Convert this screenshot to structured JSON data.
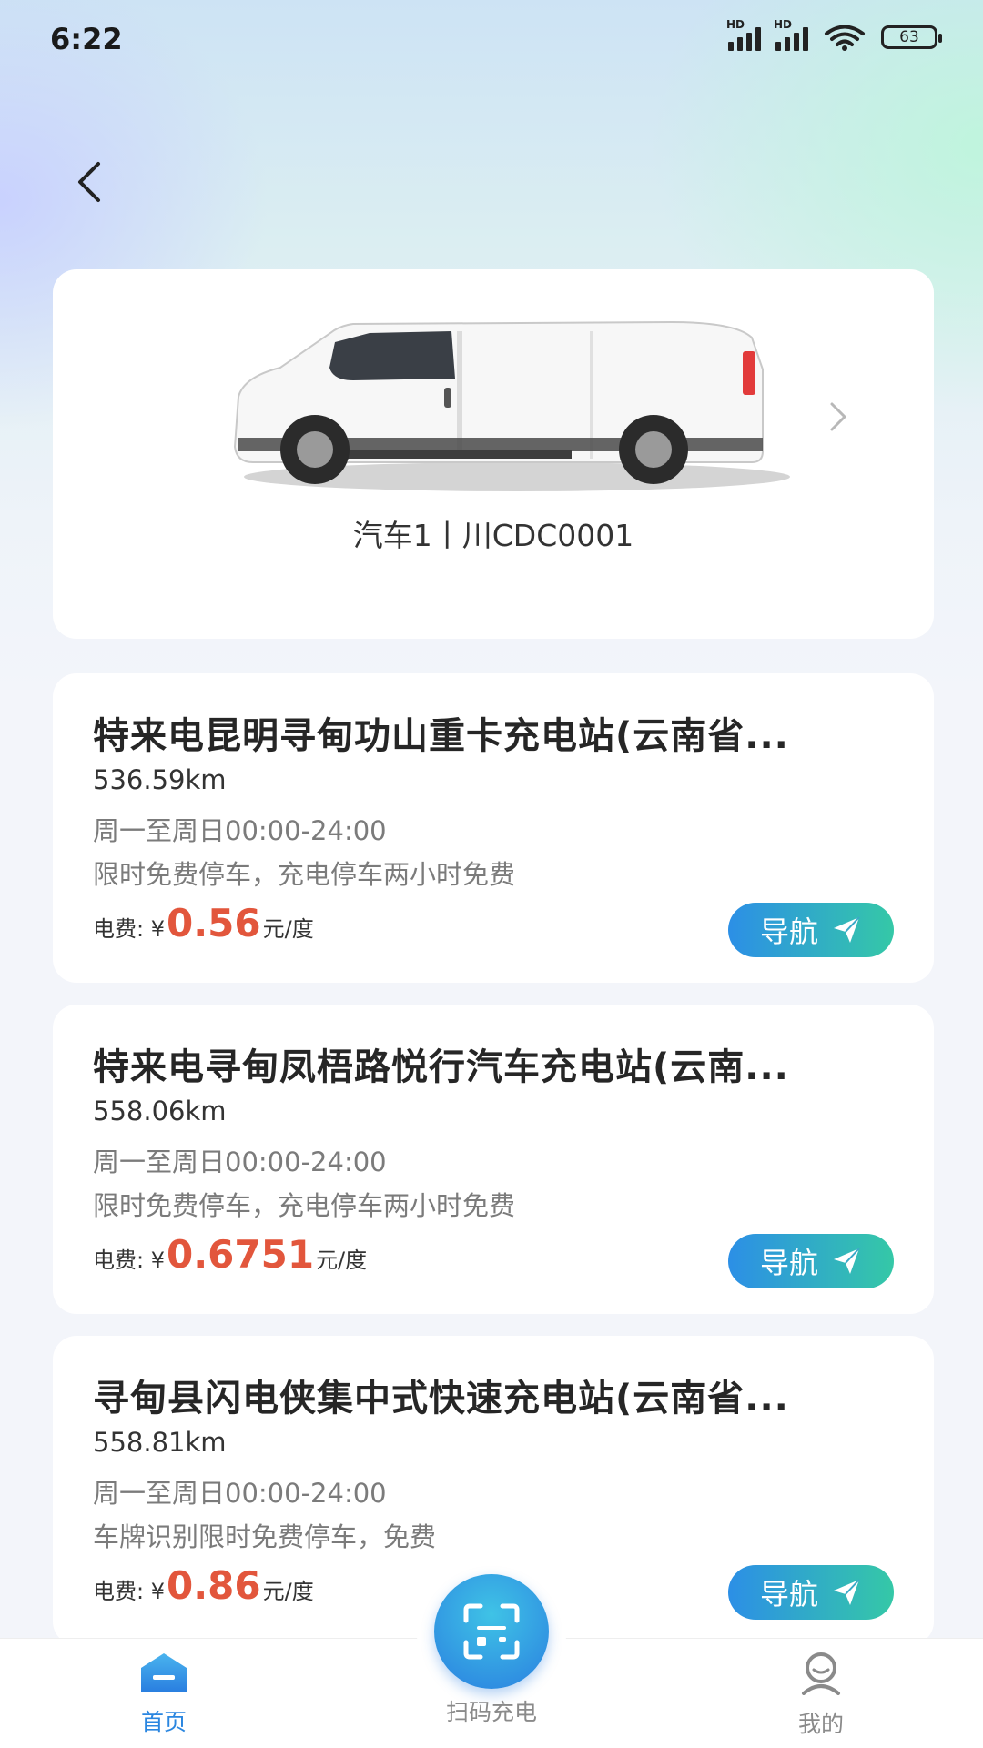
{
  "status_bar": {
    "time": "6:22",
    "battery": "63",
    "signal_label": "HD"
  },
  "vehicle": {
    "caption": "汽车1丨川CDC0001"
  },
  "stations": [
    {
      "name": "特来电昆明寻甸功山重卡充电站(云南省...",
      "distance": "536.59km",
      "hours": "周一至周日00:00-24:00",
      "note": "限时免费停车，充电停车两小时免费",
      "fee_label": "电费: ¥",
      "fee_value": "0.56",
      "fee_unit": "元/度",
      "nav_label": "导航"
    },
    {
      "name": "特来电寻甸凤梧路悦行汽车充电站(云南...",
      "distance": "558.06km",
      "hours": "周一至周日00:00-24:00",
      "note": "限时免费停车，充电停车两小时免费",
      "fee_label": "电费: ¥",
      "fee_value": "0.6751",
      "fee_unit": "元/度",
      "nav_label": "导航"
    },
    {
      "name": "寻甸县闪电侠集中式快速充电站(云南省...",
      "distance": "558.81km",
      "hours": "周一至周日00:00-24:00",
      "note": "车牌识别限时免费停车，免费",
      "fee_label": "电费: ¥",
      "fee_value": "0.86",
      "fee_unit": "元/度",
      "nav_label": "导航"
    }
  ],
  "tabbar": {
    "home": "首页",
    "scan": "扫码充电",
    "mine": "我的"
  },
  "colors": {
    "accent": "#2a86e0",
    "price": "#e2563c",
    "nav_gradient_start": "#2c8fe6",
    "nav_gradient_end": "#35c8a7"
  },
  "icons": {
    "back": "chevron-left-icon",
    "next": "chevron-right-icon",
    "nav": "send-arrow-icon",
    "home": "home-icon",
    "scan": "scan-icon",
    "mine": "profile-icon"
  }
}
